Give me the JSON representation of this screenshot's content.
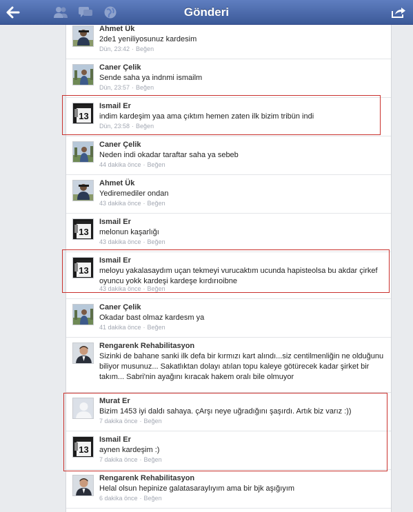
{
  "header": {
    "title": "Gönderi",
    "back_icon": "back-arrow-icon",
    "nav_icons": [
      "friends-icon",
      "messages-icon",
      "globe-icon"
    ],
    "share_icon": "share-icon"
  },
  "like_label": "Beğen",
  "comments": [
    {
      "name": "Ahmet Ük",
      "text": "2de1 yeniliyosunuz kardesim",
      "time": "Dün, 23:42",
      "avatar": "photo-person"
    },
    {
      "name": "Caner Çelik",
      "text": "Sende saha ya indnmi ismailm",
      "time": "Dün, 23:57",
      "avatar": "photo-outdoor"
    },
    {
      "name": "Ismail Er",
      "text": "indim kardeşim yaa ama çıktım hemen zaten ilk bizim tribün indi",
      "time": "Dün, 23:58",
      "avatar": "jersey-13"
    },
    {
      "name": "Caner Çelik",
      "text": "Neden indi okadar taraftar saha ya sebeb",
      "time": "44 dakika önce",
      "avatar": "photo-outdoor"
    },
    {
      "name": "Ahmet Ük",
      "text": "Yediremediler ondan",
      "time": "43 dakika önce",
      "avatar": "photo-person"
    },
    {
      "name": "Ismail Er",
      "text": "melonun kaşarlığı",
      "time": "43 dakika önce",
      "avatar": "jersey-13"
    },
    {
      "name": "Ismail Er",
      "text": "meloyu yakalasaydım uçan tekmeyi vurucaktım ucunda hapisteolsa bu akdar çirkef oyuncu yokk kardeşi kardeşe kırdırıoibne",
      "time": "43 dakika önce",
      "avatar": "jersey-13"
    },
    {
      "name": "Caner Çelik",
      "text": "Okadar bast olmaz kardesm ya",
      "time": "41 dakika önce",
      "avatar": "photo-outdoor"
    },
    {
      "name": "Rengarenk Rehabilitasyon",
      "text": "Sizinki de bahane sanki ilk defa bir kırmızı kart alındı...siz centilmenliğin ne olduğunu biliyor musunuz... Sakatlıktan dolayı atılan topu kaleye götürecek kadar şirket bir takım... Sabri'nin ayağını kıracak hakem oralı bile olmuyor",
      "time": "",
      "avatar": "photo-man-suit"
    },
    {
      "name": "Murat Er",
      "text": "Bizim 1453 iyi daldı sahaya. çArşı neye uğradığını şaşırdı. Artık biz varız :))",
      "time": "7 dakika önce",
      "avatar": "default-silhouette"
    },
    {
      "name": "Ismail Er",
      "text": "aynen kardeşim :)",
      "time": "7 dakika önce",
      "avatar": "jersey-13"
    },
    {
      "name": "Rengarenk Rehabilitasyon",
      "text": "Helal olsun hepinize galatasaraylıyım ama bir bjk aşığıyım",
      "time": "6 dakika önce",
      "avatar": "photo-man-suit"
    }
  ],
  "colors": {
    "header_top": "#5f7ec0",
    "header_bottom": "#3b5998",
    "highlight_box": "#c9302c",
    "meta_text": "#a3a8b3"
  }
}
